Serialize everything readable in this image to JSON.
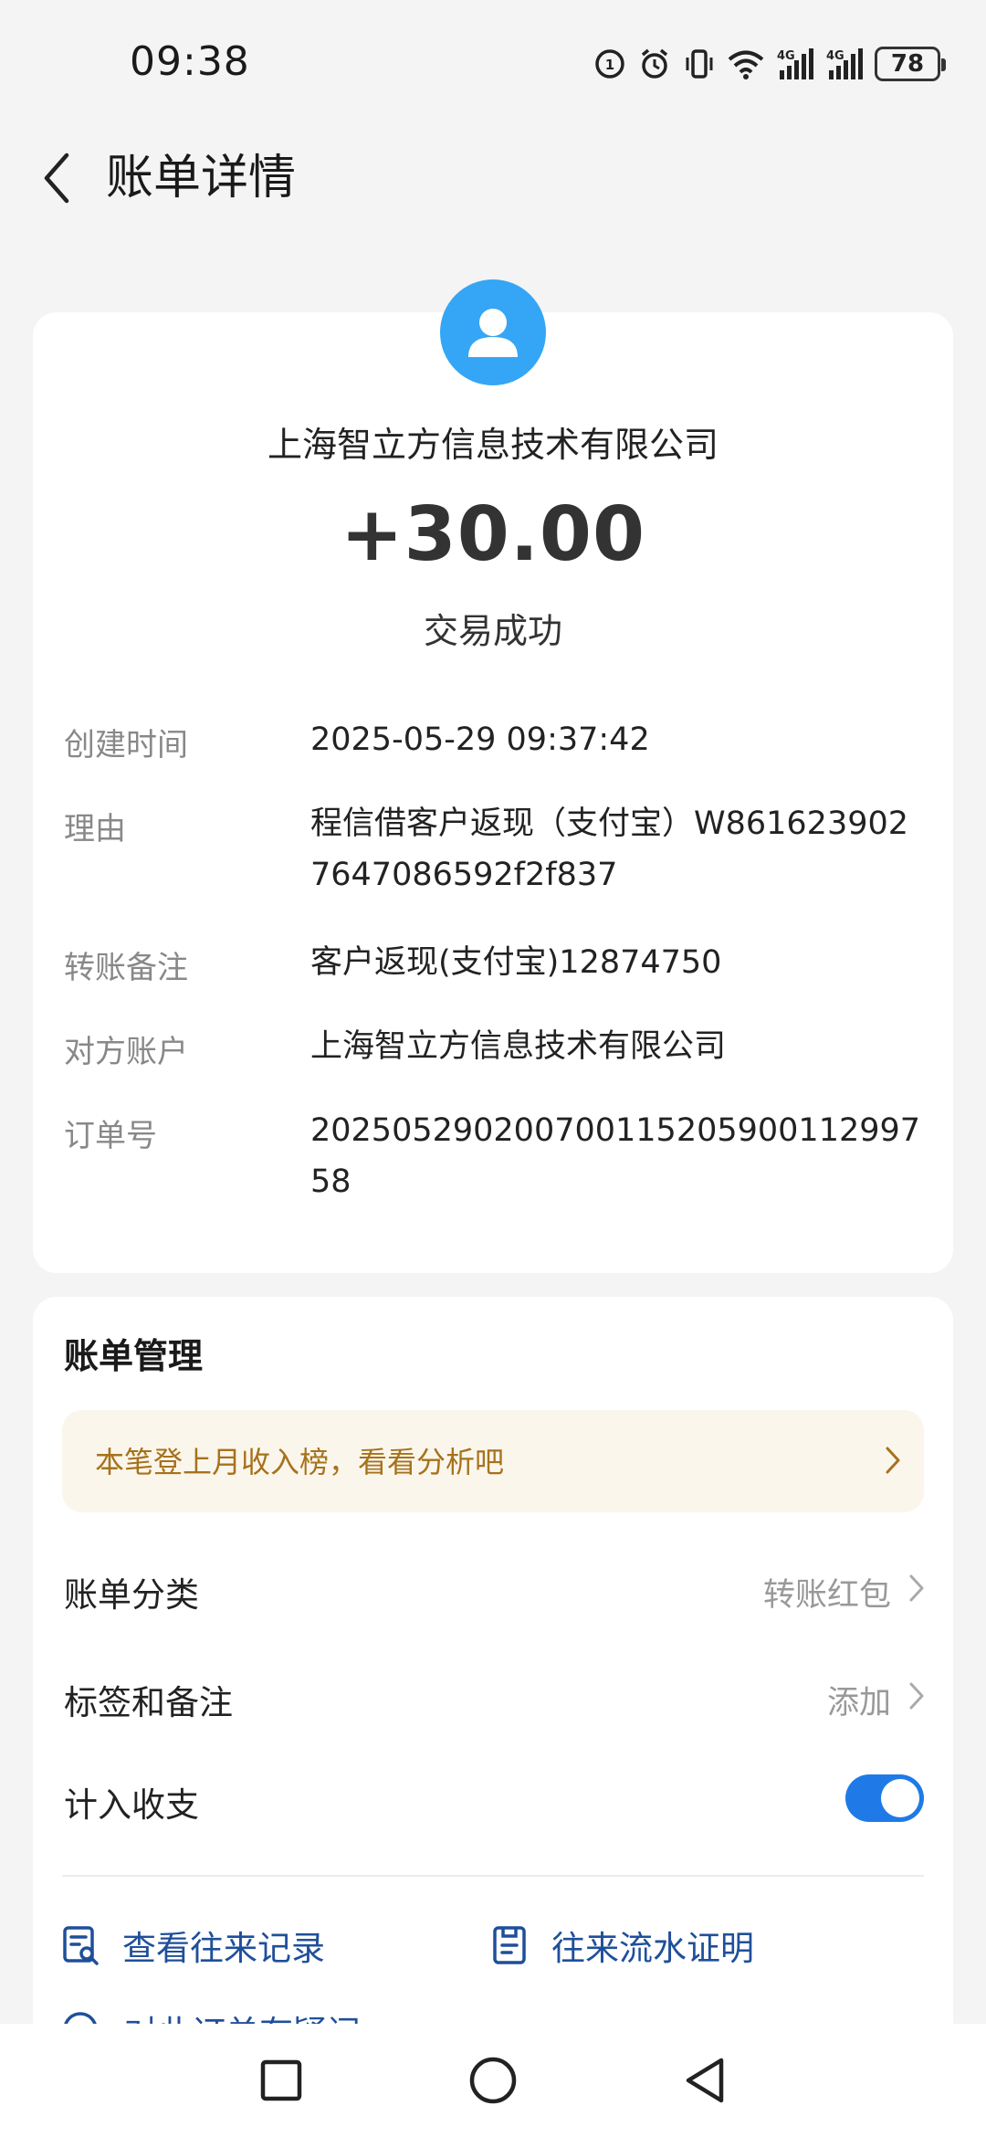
{
  "status_bar": {
    "time": "09:38",
    "battery": "78",
    "network_1": "4G",
    "network_2": "4G"
  },
  "header": {
    "title": "账单详情"
  },
  "transaction": {
    "payee": "上海智立方信息技术有限公司",
    "amount": "+30.00",
    "status": "交易成功",
    "avatar_color": "#35a6f5",
    "details": [
      {
        "label": "创建时间",
        "value": "2025-05-29 09:37:42"
      },
      {
        "label": "理由",
        "value": "程信借客户返现（支付宝）W8616239027647086592f2f837"
      },
      {
        "label": "转账备注",
        "value": "客户返现(支付宝)12874750"
      },
      {
        "label": "对方账户",
        "value": "上海智立方信息技术有限公司"
      },
      {
        "label": "订单号",
        "value": "20250529020070011520590011299758"
      }
    ]
  },
  "management": {
    "title": "账单管理",
    "banner": "本笔登上月收入榜，看看分析吧",
    "category_label": "账单分类",
    "category_value": "转账红包",
    "tags_label": "标签和备注",
    "tags_value": "添加",
    "count_label": "计入收支",
    "count_enabled": true,
    "actions": [
      {
        "label": "查看往来记录",
        "icon": "record-search-icon"
      },
      {
        "label": "往来流水证明",
        "icon": "statement-proof-icon"
      }
    ],
    "partial_action": "对此订单有疑问"
  },
  "colors": {
    "accent": "#1f7ae8",
    "link": "#1f4f9a",
    "banner_text": "#a6721c",
    "banner_bg": "#fbf6ec"
  }
}
